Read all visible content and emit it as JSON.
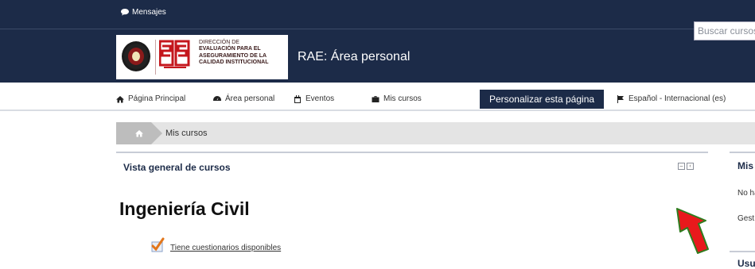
{
  "topbar": {
    "messages_label": "Mensajes"
  },
  "header": {
    "logo": {
      "number": "25",
      "line1": "DIRECCIÓN DE",
      "line2": "EVALUACIÓN PARA EL",
      "line3": "ASEGURAMIENTO DE LA",
      "line4": "CALIDAD INSTITUCIONAL"
    },
    "site_title": "RAE: Área personal",
    "search_placeholder": "Buscar cursos"
  },
  "nav": {
    "home": "Página Principal",
    "dashboard": "Área personal",
    "events": "Eventos",
    "my_courses": "Mis cursos",
    "customize_button": "Personalizar esta página",
    "language": "Español - Internacional (es)"
  },
  "breadcrumb": {
    "current": "Mis cursos"
  },
  "course_overview": {
    "title": "Vista general de cursos",
    "course_name": "Ingeniería Civil",
    "quiz_link": "Tiene cuestionarios disponibles"
  },
  "side": {
    "block1_title": "Mis",
    "block1_text1": "No ha",
    "block1_text2": "Gest",
    "block2_title": "Usu"
  },
  "colors": {
    "navy": "#1c2b48",
    "arrow_fill": "#e8191c",
    "arrow_border": "#2e7d1f"
  },
  "icons": [
    "comment-icon",
    "home-icon",
    "dashboard-icon",
    "calendar-icon",
    "briefcase-icon",
    "flag-icon",
    "checkmark-icon",
    "red-arrow-icon"
  ]
}
